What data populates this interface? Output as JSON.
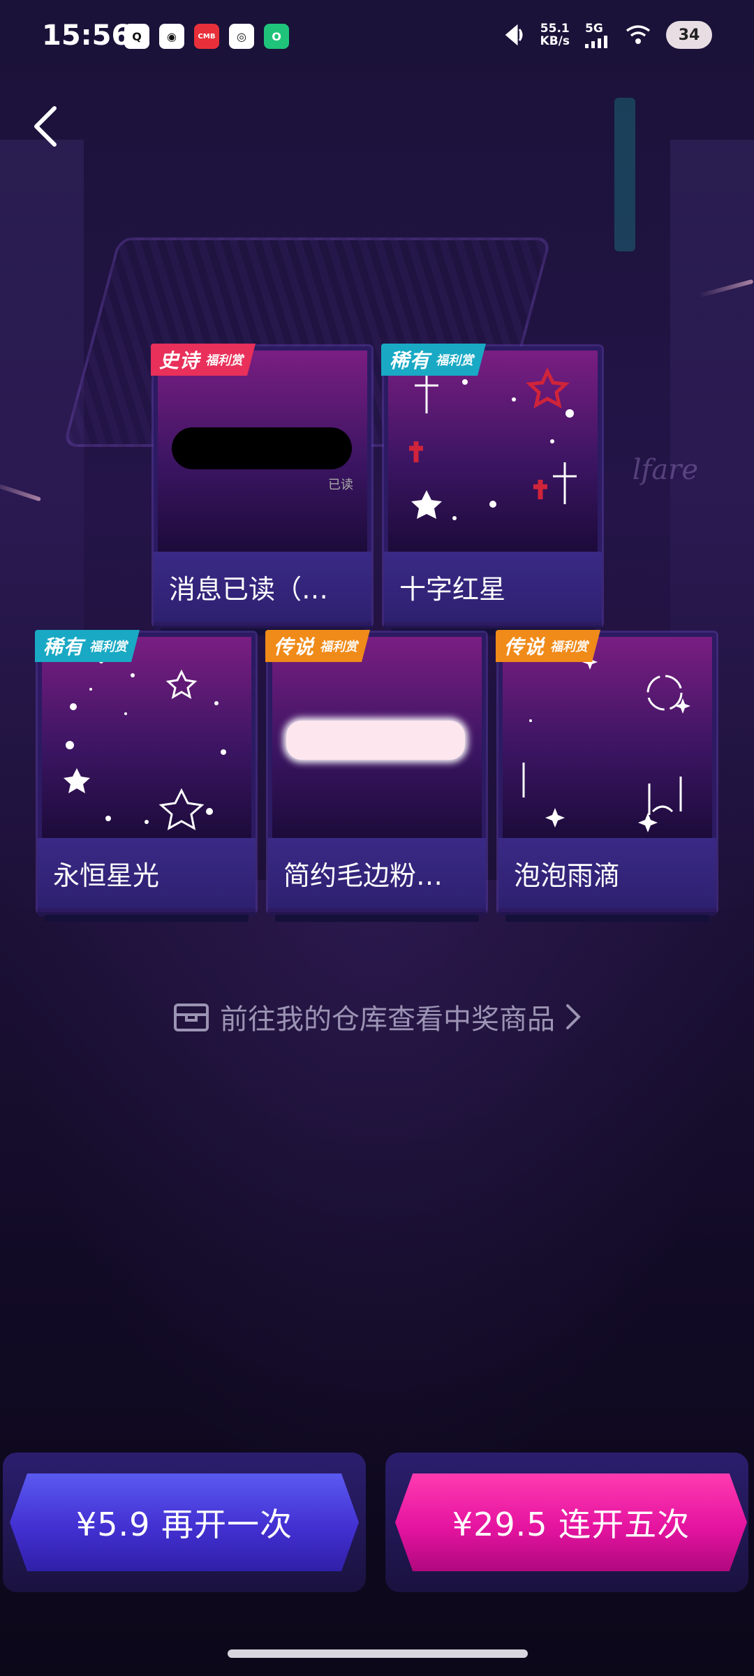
{
  "status_bar": {
    "time": "15:56",
    "apps": [
      "Q",
      "weibo",
      "CMB",
      "wechat",
      "O"
    ],
    "net_speed_value": "55.1",
    "net_speed_unit": "KB/s",
    "network": "5G",
    "battery": "34"
  },
  "background_text": "lfare",
  "cards": [
    {
      "tier": "史诗",
      "sub": "福利赏",
      "name": "消息已读（…",
      "tier_color": "#e8305a",
      "preview_text": "已读"
    },
    {
      "tier": "稀有",
      "sub": "福利赏",
      "name": "十字红星",
      "tier_color": "#19a9c4"
    },
    {
      "tier": "稀有",
      "sub": "福利赏",
      "name": "永恒星光",
      "tier_color": "#19a9c4"
    },
    {
      "tier": "传说",
      "sub": "福利赏",
      "name": "简约毛边粉…",
      "tier_color": "#f08a18"
    },
    {
      "tier": "传说",
      "sub": "福利赏",
      "name": "泡泡雨滴",
      "tier_color": "#f08a18"
    }
  ],
  "warehouse_link": {
    "icon": "box-icon",
    "label": "前往我的仓库查看中奖商品"
  },
  "buttons": {
    "once": "¥5.9 再开一次",
    "five": "¥29.5 连开五次"
  }
}
